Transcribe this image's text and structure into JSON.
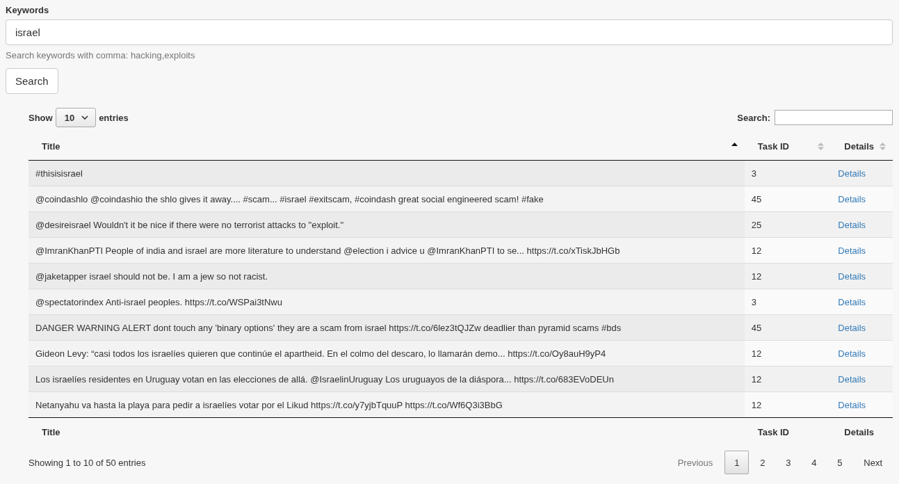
{
  "keywords": {
    "label": "Keywords",
    "value": "israel",
    "help": "Search keywords with comma: hacking,exploits",
    "button": "Search"
  },
  "table_controls": {
    "show_label": "Show",
    "page_size": "10",
    "entries_label": "entries",
    "search_label": "Search:"
  },
  "table": {
    "columns": [
      {
        "label": "Title",
        "sorted": true
      },
      {
        "label": "Task ID",
        "sorted": false
      },
      {
        "label": "Details",
        "sorted": false
      }
    ],
    "rows": [
      {
        "title": "#thisisisrael",
        "task_id": "3",
        "details": "Details"
      },
      {
        "title": "@coindashlo @coindashio the shlo gives it away.... #scam... #israel #exitscam, #coindash great social engineered scam! #fake",
        "task_id": "45",
        "details": "Details"
      },
      {
        "title": "@desireisrael Wouldn't it be nice if there were no terrorist attacks to \"exploit.\"",
        "task_id": "25",
        "details": "Details"
      },
      {
        "title": "@ImranKhanPTI People of india and israel are more literature to understand @election i advice u @ImranKhanPTI to se... https://t.co/xTiskJbHGb",
        "task_id": "12",
        "details": "Details"
      },
      {
        "title": "@jaketapper israel should not be. I am a jew so not racist.",
        "task_id": "12",
        "details": "Details"
      },
      {
        "title": "@spectatorindex Anti-israel peoples. https://t.co/WSPai3tNwu",
        "task_id": "3",
        "details": "Details"
      },
      {
        "title": "DANGER WARNING ALERT dont touch any 'binary options' they are a scam from israel https://t.co/6lez3tQJZw deadlier than pyramid scams #bds",
        "task_id": "45",
        "details": "Details"
      },
      {
        "title": "Gideon Levy: “casi todos los israelíes quieren que continúe el apartheid. En el colmo del descaro, lo llamarán demo... https://t.co/Oy8auH9yP4",
        "task_id": "12",
        "details": "Details"
      },
      {
        "title": "Los israelíes residentes en Uruguay votan en las elecciones de allá. @IsraelinUruguay Los uruguayos de la diáspora... https://t.co/683EVoDEUn",
        "task_id": "12",
        "details": "Details"
      },
      {
        "title": "Netanyahu va hasta la playa para pedir a israelíes votar por el Likud https://t.co/y7yjbTquuP https://t.co/Wf6Q3i3BbG",
        "task_id": "12",
        "details": "Details"
      }
    ],
    "footer": [
      "Title",
      "Task ID",
      "Details"
    ]
  },
  "info": "Showing 1 to 10 of 50 entries",
  "pagination": [
    {
      "label": "Previous",
      "kind": "nav",
      "disabled": true,
      "selected": false
    },
    {
      "label": "1",
      "kind": "page",
      "disabled": false,
      "selected": true
    },
    {
      "label": "2",
      "kind": "page",
      "disabled": false,
      "selected": false
    },
    {
      "label": "3",
      "kind": "page",
      "disabled": false,
      "selected": false
    },
    {
      "label": "4",
      "kind": "page",
      "disabled": false,
      "selected": false
    },
    {
      "label": "5",
      "kind": "page",
      "disabled": false,
      "selected": false
    },
    {
      "label": "Next",
      "kind": "nav",
      "disabled": false,
      "selected": false
    }
  ]
}
